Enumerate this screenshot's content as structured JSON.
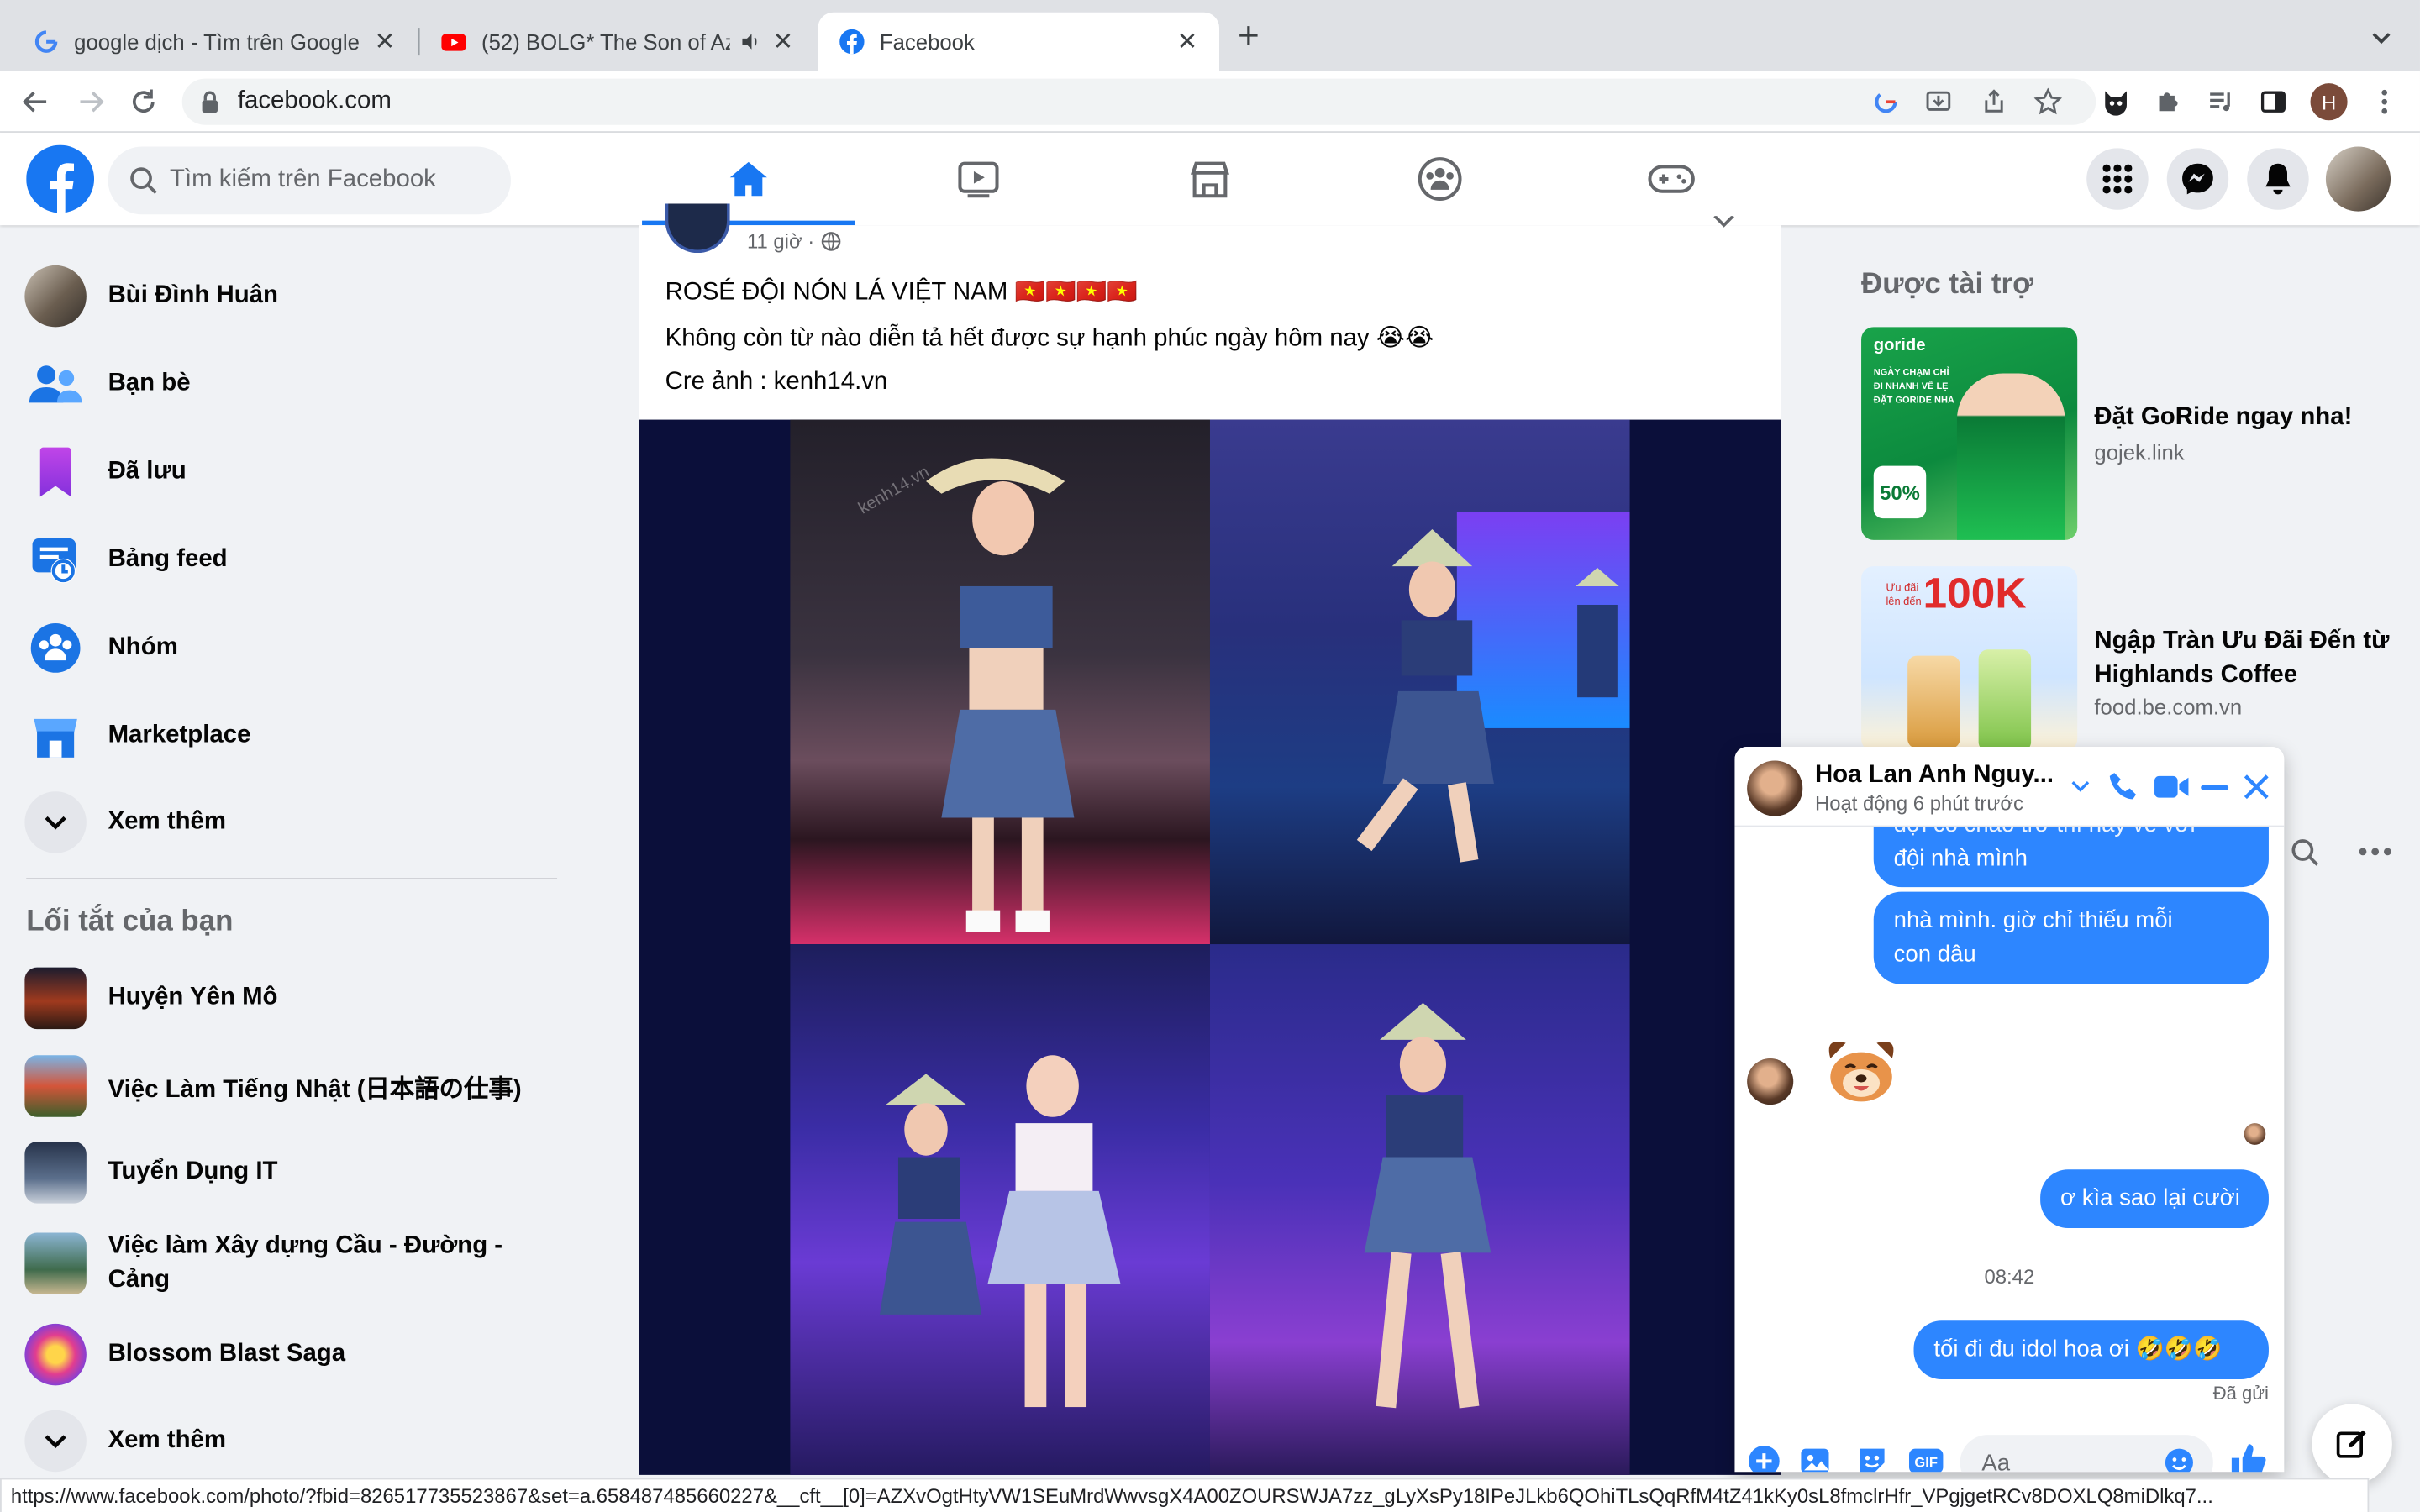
{
  "browser": {
    "tabs": [
      {
        "title": "google dịch - Tìm trên Google",
        "close": "✕"
      },
      {
        "title": "(52) BOLG* The Son of Azo",
        "close": "✕"
      },
      {
        "title": "Facebook",
        "close": "✕"
      }
    ],
    "new_tab": "+",
    "url": "facebook.com",
    "profile_initial": "H",
    "status_url": "https://www.facebook.com/photo/?fbid=826517735523867&set=a.658487485660227&__cft__[0]=AZXvOgtHtyVW1SEuMrdWwvsgX4A00ZOURSWJA7zz_gLyXsPy18IPeJLkb6QOhiTLsQqRfM4tZ41kKy0sL8fmclrHfr_VPgjgetRCv8DOXLQ8miDlkq7..."
  },
  "fb": {
    "search_placeholder": "Tìm kiếm trên Facebook",
    "colors": {
      "brand": "#1877f2",
      "messenger_blue": "#2d86ff"
    }
  },
  "sidebar": {
    "items": [
      {
        "label": "Bùi Đình Huân",
        "icon": "avatar"
      },
      {
        "label": "Bạn bè",
        "icon": "friends-icon"
      },
      {
        "label": "Đã lưu",
        "icon": "saved-icon"
      },
      {
        "label": "Bảng feed",
        "icon": "feed-icon"
      },
      {
        "label": "Nhóm",
        "icon": "groups-icon"
      },
      {
        "label": "Marketplace",
        "icon": "marketplace-icon"
      },
      {
        "label": "Xem thêm",
        "icon": "chevron-down-icon"
      }
    ],
    "shortcuts_title": "Lối tắt của bạn",
    "shortcuts": [
      {
        "label": "Huyện Yên Mô"
      },
      {
        "label": "Việc Làm Tiếng Nhật (日本語の仕事)"
      },
      {
        "label": "Tuyển Dụng IT"
      },
      {
        "label": "Việc làm Xây dựng Cầu - Đường -",
        "label2": "Cảng"
      },
      {
        "label": "Blossom Blast Saga"
      },
      {
        "label": "Xem thêm"
      }
    ]
  },
  "post": {
    "time": "11 giờ ·",
    "line1": "ROSÉ ĐỘI NÓN LÁ VIỆT NAM 🇻🇳🇻🇳🇻🇳🇻🇳",
    "line2": "Không còn từ nào diễn tả hết được sự hạnh phúc ngày hôm nay 😭😭",
    "line3": "Cre ảnh : kenh14.vn",
    "watermark": "kenh14.vn"
  },
  "sponsored": {
    "title": "Được tài trợ",
    "ads": [
      {
        "title": "Đặt GoRide ngay nha!",
        "domain": "gojek.link",
        "image_text": [
          "goride",
          "NGÀY CHẠM CHỈ",
          "ĐI NHANH VỀ LẸ",
          "ĐẶT GORIDE NHA",
          "50%"
        ]
      },
      {
        "title": "Ngập Tràn Ưu Đãi Đến từ",
        "title2": "Highlands Coffee",
        "domain": "food.be.com.vn",
        "image_text": [
          "Ưu đãi lên đến",
          "100K"
        ]
      }
    ]
  },
  "chat": {
    "name": "Hoa Lan Anh Nguy...",
    "status": "Hoạt động 6 phút trước",
    "messages": [
      {
        "from": "me",
        "text": "đội nhà mình",
        "partial": "đợi cô chào trở thì nay về với"
      },
      {
        "from": "me",
        "text": "nhà mình. giờ chỉ thiếu mỗi",
        "text2": "con dâu"
      },
      {
        "from": "me",
        "text": "ơ kìa sao lại cười"
      },
      {
        "from": "me",
        "text": "tối đi đu idol hoa ơi 🤣🤣🤣"
      }
    ],
    "time_divider": "08:42",
    "sent": "Đã gửi",
    "input_placeholder": "Aa"
  }
}
